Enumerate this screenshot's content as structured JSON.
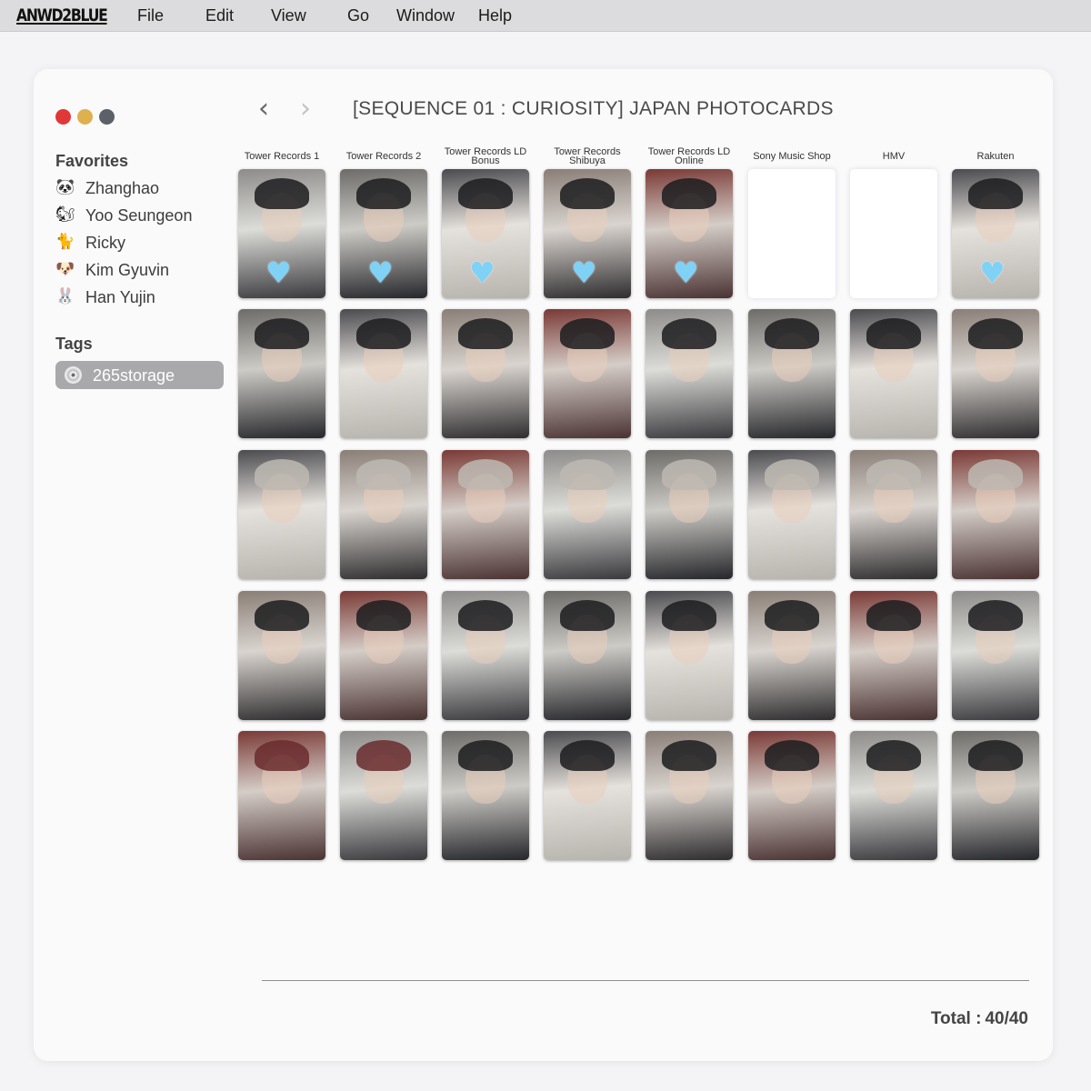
{
  "menubar": {
    "logo": "ANWD2BLUE",
    "items": [
      "File",
      "Edit",
      "View",
      "Go",
      "Window",
      "Help"
    ]
  },
  "window": {
    "title": "[SEQUENCE 01 : CURIOSITY] JAPAN PHOTOCARDS",
    "nav": {
      "back": "‹",
      "forward": "›"
    }
  },
  "sidebar": {
    "favorites_heading": "Favorites",
    "favorites": [
      {
        "emoji": "🐼",
        "icon": "panda-icon",
        "label": "Zhanghao"
      },
      {
        "emoji": "🐿",
        "icon": "squirrel-icon",
        "label": "Yoo Seungeon"
      },
      {
        "emoji": "🐈",
        "icon": "cat-icon",
        "label": "Ricky"
      },
      {
        "emoji": "🐶",
        "icon": "puppy-icon",
        "label": "Kim Gyuvin"
      },
      {
        "emoji": "🐰",
        "icon": "rabbit-icon",
        "label": "Han Yujin"
      }
    ],
    "tags_heading": "Tags",
    "tags": [
      {
        "icon": "cd-icon",
        "label": "265storage"
      }
    ]
  },
  "grid": {
    "columns": [
      "Tower Records 1",
      "Tower Records 2",
      "Tower Records LD Bonus",
      "Tower Records Shibuya",
      "Tower Records LD Online",
      "Sony Music Shop",
      "HMV",
      "Rakuten"
    ],
    "heart_icon": "♥",
    "heart_color": "#7fd2f6",
    "row1_hearts": [
      true,
      true,
      true,
      true,
      true,
      false,
      false,
      true
    ],
    "row1_blank": [
      false,
      false,
      false,
      false,
      false,
      true,
      true,
      false
    ]
  },
  "footer": {
    "total_label": "Total :",
    "total_value": "40/40"
  }
}
